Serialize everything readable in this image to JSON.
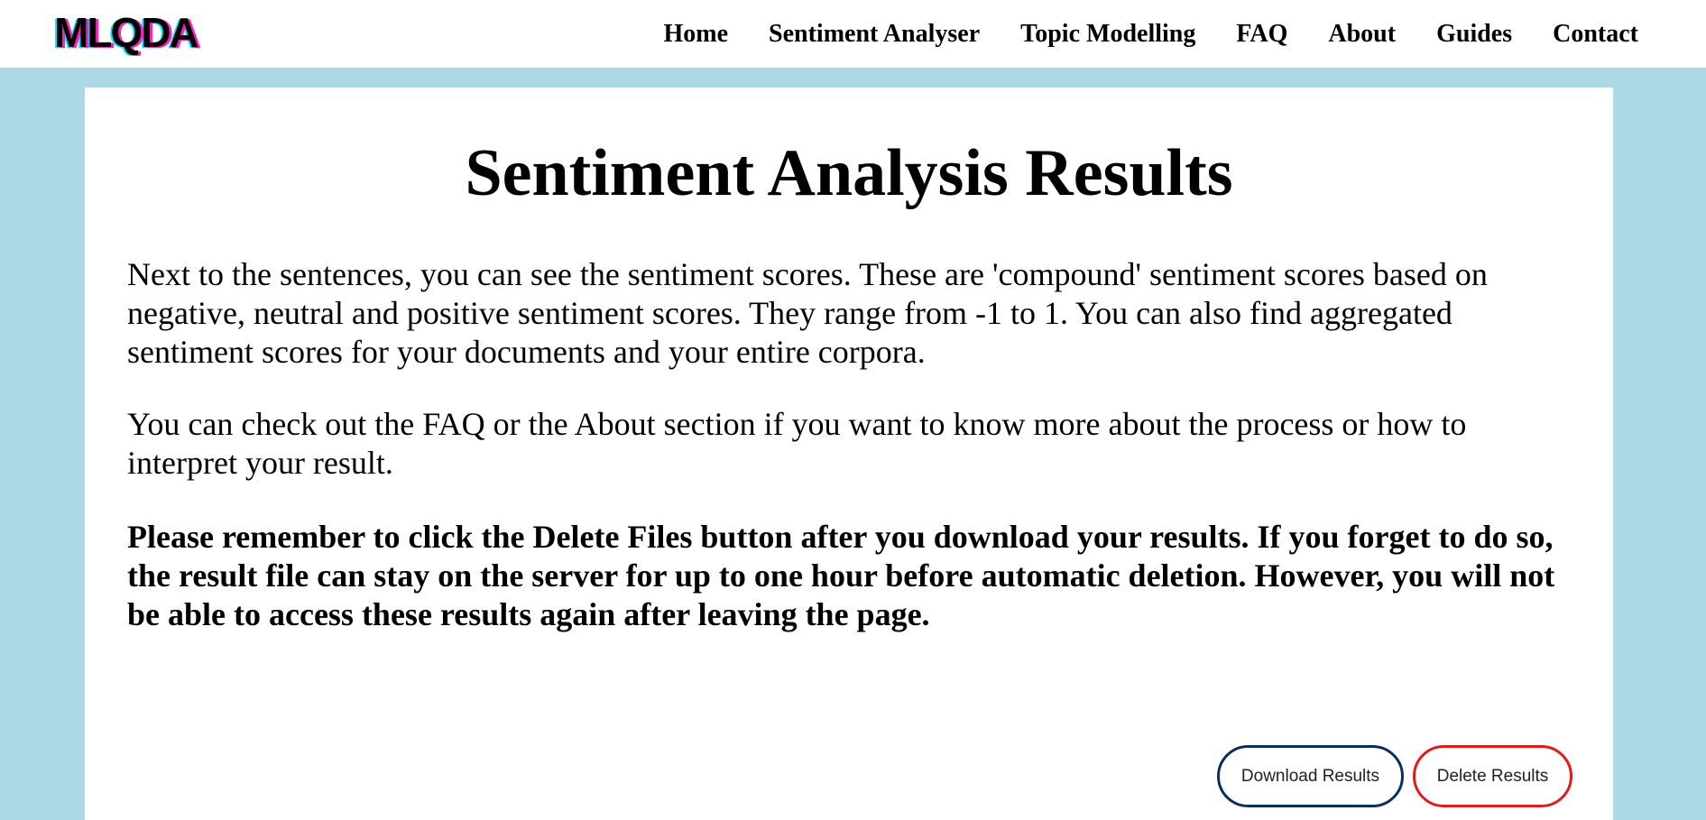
{
  "header": {
    "logo_text": "MLQDA",
    "nav": [
      {
        "label": "Home"
      },
      {
        "label": "Sentiment Analyser"
      },
      {
        "label": "Topic Modelling"
      },
      {
        "label": "FAQ"
      },
      {
        "label": "About"
      },
      {
        "label": "Guides"
      },
      {
        "label": "Contact"
      }
    ]
  },
  "main": {
    "title": "Sentiment Analysis Results",
    "paragraphs": [
      "Next to the sentences, you can see the sentiment scores. These are 'compound' sentiment scores based on negative, neutral and positive sentiment scores. They range from -1 to 1. You can also find aggregated sentiment scores for your documents and your entire corpora.",
      "You can check out the FAQ or the About section if you want to know more about the process or how to interpret your result.",
      "Please remember to click the Delete Files button after you download your results. If you forget to do so, the result file can stay on the server for up to one hour before automatic deletion. However, you will not be able to access these results again after leaving the page."
    ],
    "buttons": {
      "download_label": "Download Results",
      "delete_label": "Delete Results"
    }
  },
  "colors": {
    "background": "#add8e6",
    "logo_cyan": "#00e5ff",
    "logo_magenta": "#ff1fb4",
    "download_border": "#0b2f5c",
    "delete_border": "#e01b1b"
  },
  "icons": {
    "logo": "mlqda-glitch-logo"
  }
}
